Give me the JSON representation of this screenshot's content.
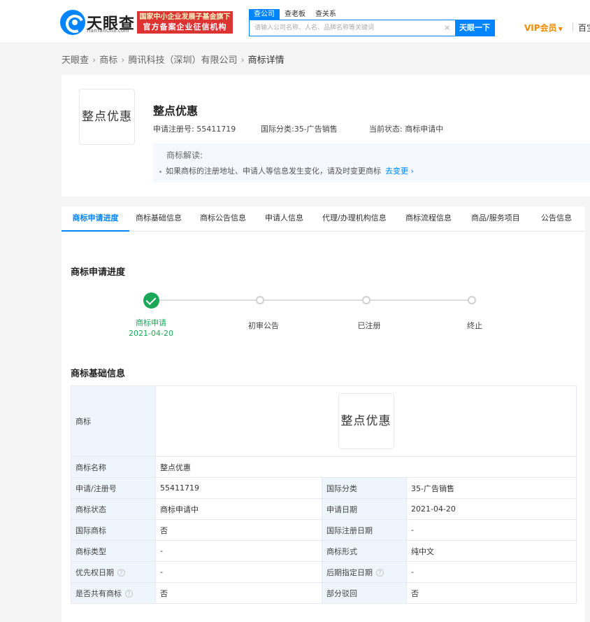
{
  "header": {
    "logo_text": "天眼查",
    "logo_sub": "TianYanCha.com",
    "cert_line1": "国家中小企业发展子基金旗下",
    "cert_line2": "官方备案企业征信机构",
    "search_tabs": [
      "查公司",
      "查老板",
      "查关系"
    ],
    "search_placeholder": "请输入公司名称、人名、品牌名称等关键词",
    "search_button": "天眼一下",
    "vip_label": "VIP会员",
    "baike_label": "百宝"
  },
  "breadcrumb": [
    "天眼查",
    "商标",
    "腾讯科技（深圳）有限公司",
    "商标详情"
  ],
  "trademark": {
    "image_text": "整点优惠",
    "name": "整点优惠",
    "reg_no_label": "申请注册号:",
    "reg_no": "55411719",
    "intl_class_label": "国际分类:",
    "intl_class": "35-广告销售",
    "status_label": "当前状态:",
    "status": "商标申请中",
    "tip_title": "商标解读:",
    "tip_text": "如果商标的注册地址、申请人等信息发生变化，请及时变更商标",
    "tip_link": "去变更"
  },
  "tabs": [
    "商标申请进度",
    "商标基础信息",
    "商标公告信息",
    "申请人信息",
    "代理/办理机构信息",
    "商标流程信息",
    "商品/服务项目",
    "公告信息"
  ],
  "progress": {
    "title": "商标申请进度",
    "steps": [
      {
        "label": "商标申请",
        "date": "2021-04-20",
        "done": true
      },
      {
        "label": "初审公告",
        "date": "",
        "done": false
      },
      {
        "label": "已注册",
        "date": "",
        "done": false
      },
      {
        "label": "终止",
        "date": "",
        "done": false
      }
    ]
  },
  "basic_info": {
    "title": "商标基础信息",
    "trademark_label": "商标",
    "trademark_image_text": "整点优惠",
    "name_label": "商标名称",
    "name_value": "整点优惠",
    "rows": [
      {
        "k1": "申请/注册号",
        "v1": "55411719",
        "k2": "国际分类",
        "v2": "35-广告销售"
      },
      {
        "k1": "商标状态",
        "v1": "商标申请中",
        "k2": "申请日期",
        "v2": "2021-04-20"
      },
      {
        "k1": "国际商标",
        "v1": "否",
        "k2": "国际注册日期",
        "v2": "-"
      },
      {
        "k1": "商标类型",
        "v1": "-",
        "k2": "商标形式",
        "v2": "纯中文"
      },
      {
        "k1": "优先权日期",
        "v1": "-",
        "k2": "后期指定日期",
        "v2": "-"
      },
      {
        "k1": "是否共有商标",
        "v1": "否",
        "k2": "部分驳回",
        "v2": "否"
      }
    ]
  },
  "colors": {
    "brand_blue": "#0084ff",
    "success_green": "#1aa858",
    "vip_orange": "#f08c00",
    "badge_red": "#dd3333"
  }
}
